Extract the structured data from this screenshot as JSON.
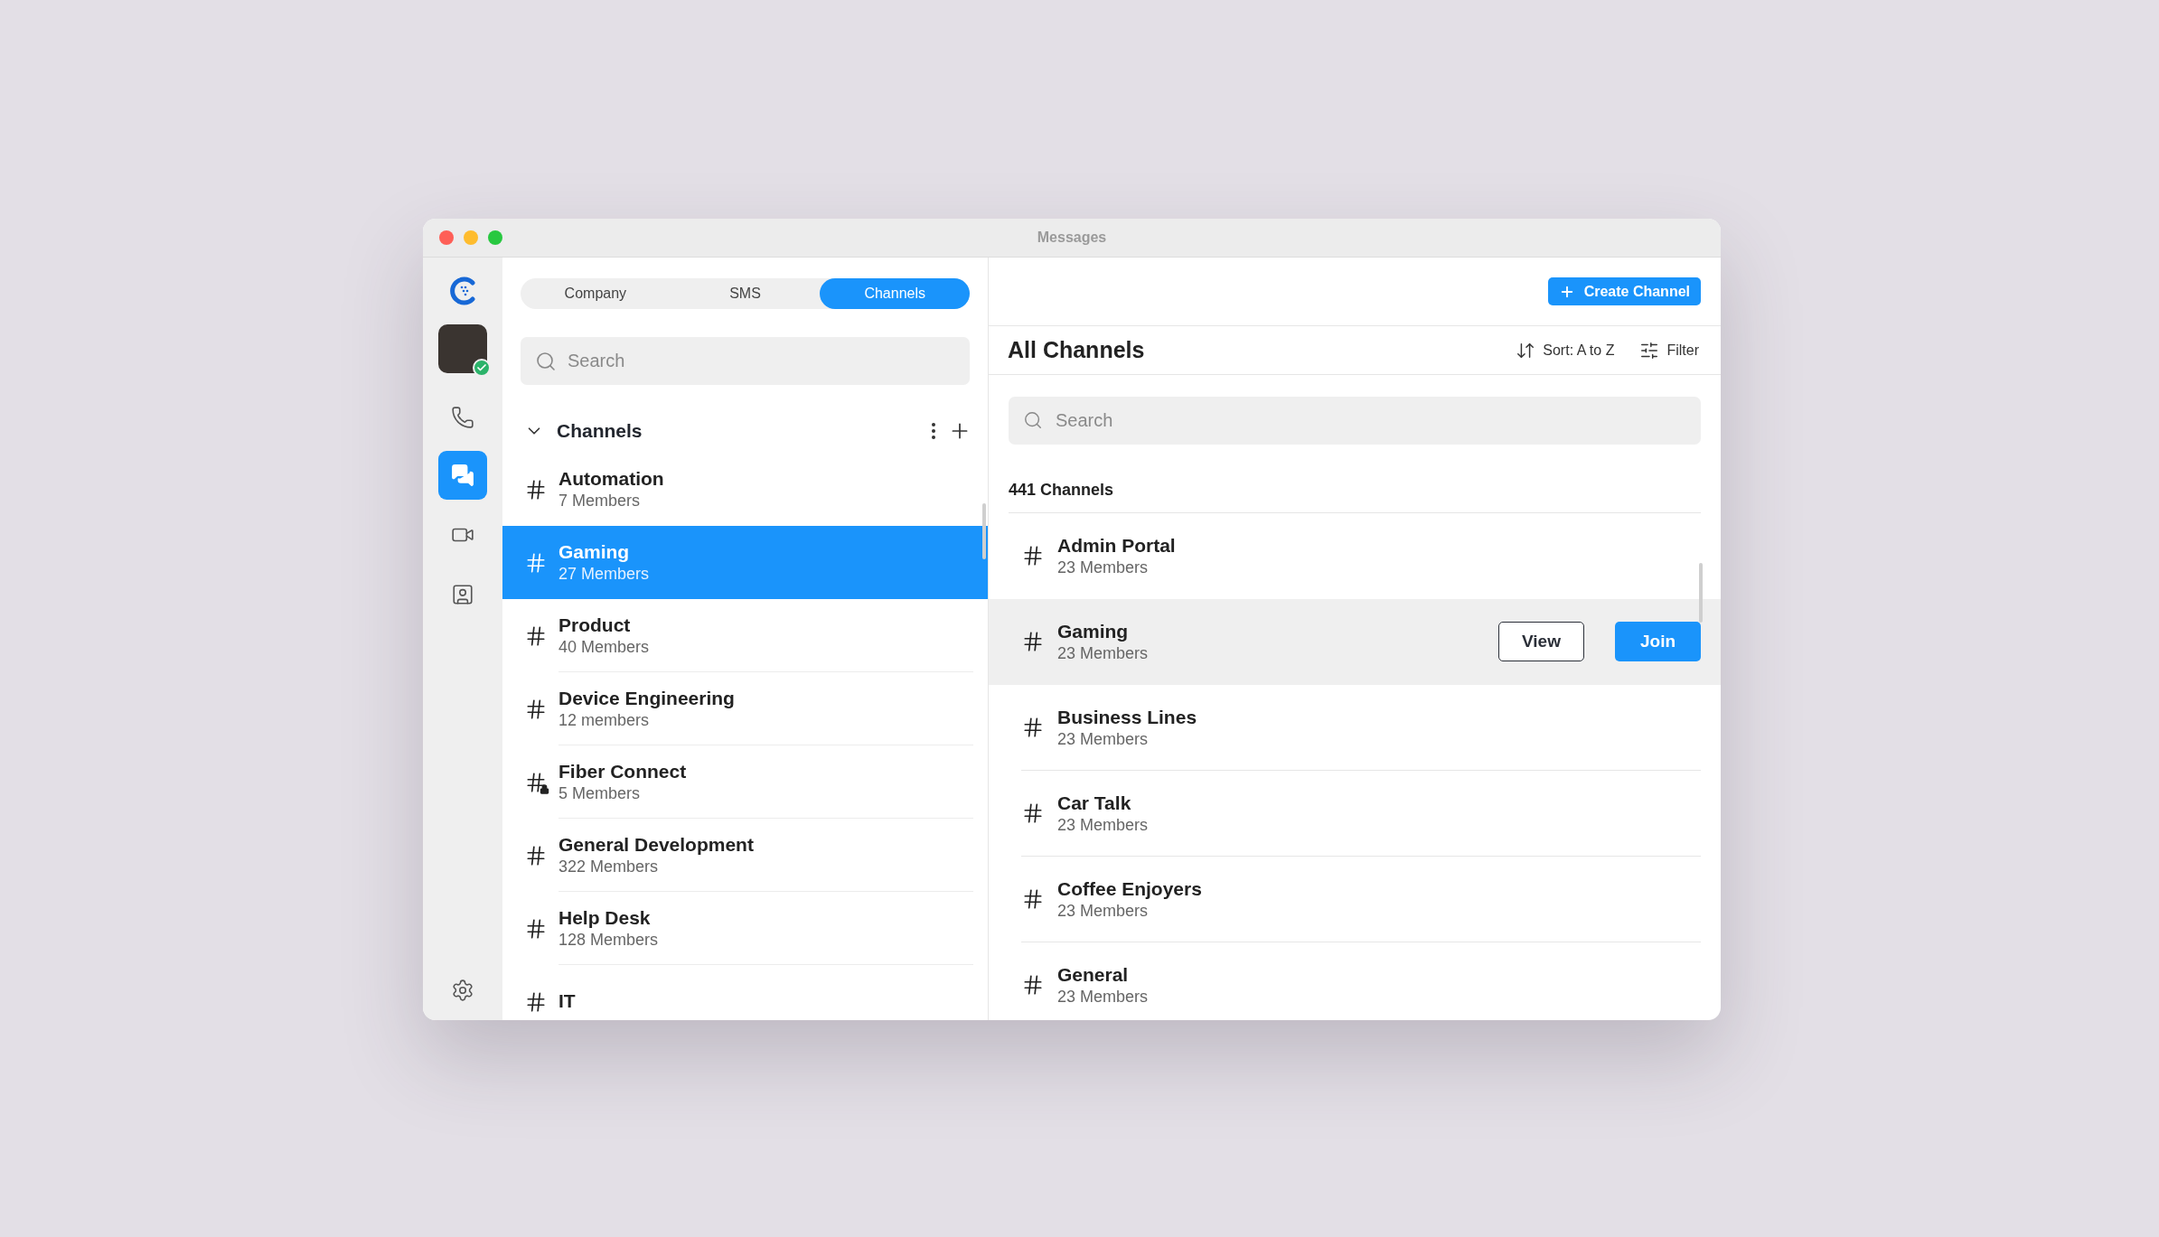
{
  "window": {
    "title": "Messages"
  },
  "rail": {
    "avatar": {
      "online": true
    },
    "nav": [
      {
        "kind": "phone",
        "selected": false
      },
      {
        "kind": "messages",
        "selected": true
      },
      {
        "kind": "video",
        "selected": false
      },
      {
        "kind": "contacts",
        "selected": false
      }
    ]
  },
  "tabs": [
    {
      "label": "Company",
      "selected": false
    },
    {
      "label": "SMS",
      "selected": false
    },
    {
      "label": "Channels",
      "selected": true
    }
  ],
  "list_search": {
    "placeholder": "Search"
  },
  "section": {
    "title": "Channels",
    "expanded": true
  },
  "channels": [
    {
      "name": "Automation",
      "members": "7 Members",
      "kind": "public",
      "selected": false
    },
    {
      "name": "Gaming",
      "members": "27 Members",
      "kind": "public",
      "selected": true
    },
    {
      "name": "Product",
      "members": "40 Members",
      "kind": "public",
      "selected": false
    },
    {
      "name": "Device Engineering",
      "members": "12 members",
      "kind": "public",
      "selected": false
    },
    {
      "name": "Fiber Connect",
      "members": "5 Members",
      "kind": "private",
      "selected": false
    },
    {
      "name": "General Development",
      "members": "322 Members",
      "kind": "public",
      "selected": false
    },
    {
      "name": "Help Desk",
      "members": "128 Members",
      "kind": "public",
      "selected": false
    },
    {
      "name": "IT",
      "kind": "public",
      "selected": false
    }
  ],
  "create_button": "Create Channel",
  "directory": {
    "title": "All Channels",
    "sort": "Sort: A to Z",
    "filter": "Filter",
    "search_placeholder": "Search",
    "count": "441 Channels",
    "view_label": "View",
    "join_label": "Join",
    "rows": [
      {
        "name": "Admin Portal",
        "members": "23 Members",
        "selected": false
      },
      {
        "name": "Gaming",
        "members": "23 Members",
        "selected": true
      },
      {
        "name": "Business Lines",
        "members": "23 Members",
        "selected": false
      },
      {
        "name": "Car Talk",
        "members": "23 Members",
        "selected": false
      },
      {
        "name": "Coffee Enjoyers",
        "members": "23 Members",
        "selected": false
      },
      {
        "name": "General",
        "members": "23 Members",
        "selected": false
      }
    ]
  }
}
